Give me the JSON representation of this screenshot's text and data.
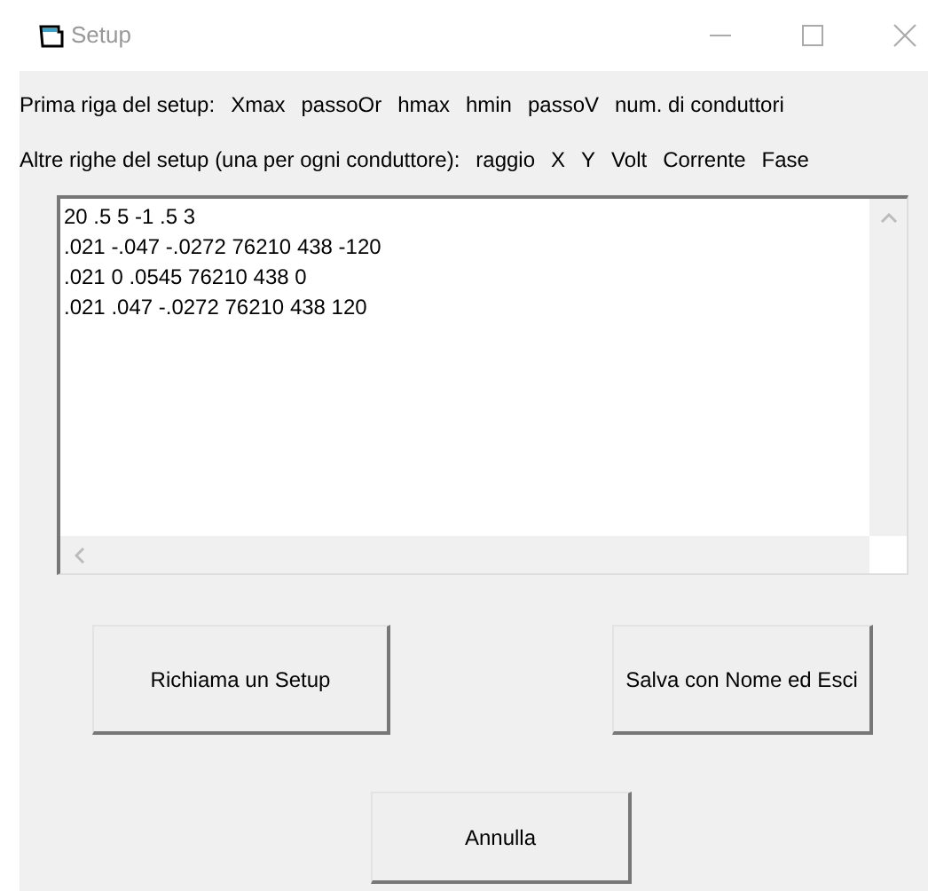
{
  "window": {
    "title": "Setup"
  },
  "header_lines": [
    {
      "label": "Prima riga del setup:",
      "fields": [
        "Xmax",
        "passoOr",
        "hmax",
        "hmin",
        "passoV",
        "num. di conduttori"
      ]
    },
    {
      "label": "Altre righe del setup (una per ogni conduttore):",
      "fields": [
        "raggio",
        "X",
        "Y",
        "Volt",
        "Corrente",
        "Fase"
      ]
    }
  ],
  "setup_text": {
    "lines": [
      "20 .5 5 -1 .5 3",
      ".021 -.047 -.0272 76210 438 -120",
      ".021 0 .0545 76210 438 0",
      ".021 .047 -.0272 76210 438 120"
    ]
  },
  "buttons": [
    "Richiama un Setup",
    "Salva con Nome ed Esci",
    "Annulla"
  ]
}
